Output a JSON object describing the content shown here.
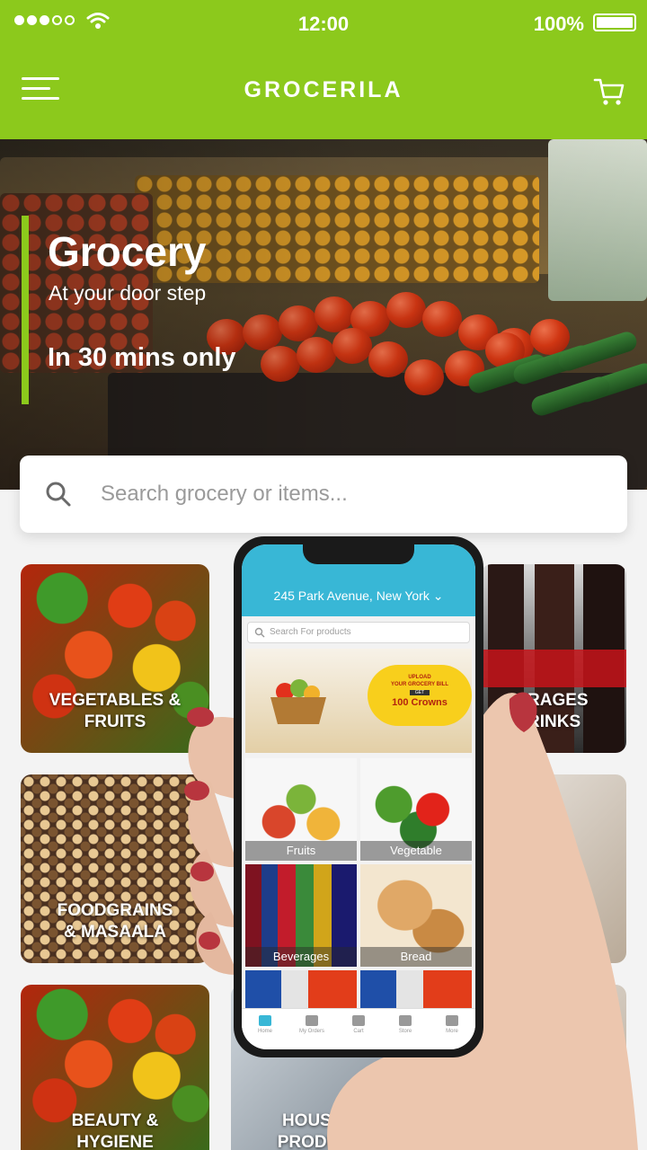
{
  "status": {
    "time": "12:00",
    "battery": "100%",
    "battery_level": 1.0
  },
  "header": {
    "title": "GROCERILA"
  },
  "hero": {
    "title": "Grocery",
    "subtitle": "At your door step",
    "tagline": "In 30 mins only"
  },
  "search": {
    "placeholder": "Search grocery or items..."
  },
  "categories": [
    {
      "label_line1": "VEGETABLES &",
      "label_line2": "FRUITS"
    },
    {
      "label_line1": "RAGES",
      "label_line2": "RINKS"
    },
    {
      "label_line1": "FOODGRAINS",
      "label_line2": "& MASAALA"
    },
    {
      "label_line1": "BEAUTY &",
      "label_line2": "HYGIENE"
    },
    {
      "label_line1": "HOUSEHO",
      "label_line2": "PRODUCTS"
    }
  ],
  "phone": {
    "address": "245 Park Avenue, New York",
    "search_placeholder": "Search For products",
    "banner": {
      "line1": "UPLOAD",
      "line2": "YOUR GROCERY BILL",
      "line3": "GET",
      "line4": "100 Crowns"
    },
    "tiles": [
      "Fruits",
      "Vegetable",
      "Beverages",
      "Bread"
    ],
    "nav": [
      "Home",
      "My Orders",
      "Cart",
      "Store",
      "More"
    ]
  },
  "colors": {
    "brand_green": "#8cc91c",
    "phone_accent": "#38b7d6"
  }
}
